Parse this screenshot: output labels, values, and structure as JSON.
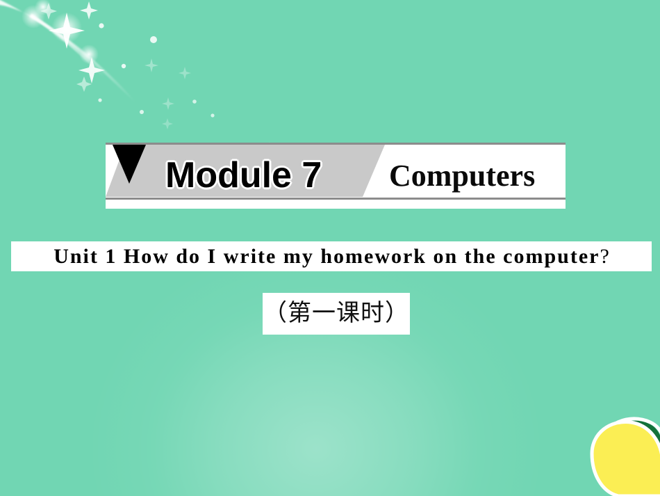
{
  "slide": {
    "background_color": "#71d6b3",
    "panel_color": "#ffffff"
  },
  "banner": {
    "module_label": "Module 7",
    "topic_label": "Computers",
    "slab_color": "#c9c9c9",
    "rule_color": "#8c8c8c",
    "triangle_color": "#000000",
    "triangle_icon_name": "down-triangle-marker"
  },
  "unit": {
    "title_main": "Unit 1    How do I write my homework on the computer",
    "title_question_mark": "?"
  },
  "period": {
    "caption": "（第一课时）"
  },
  "decorations": {
    "sparkle_name": "sparkle-comet-decoration",
    "lemon_name": "lemon-fruit-decoration",
    "lemon_body_color": "#fbee54",
    "lemon_leaf_color": "#13713a",
    "lemon_outline_color": "#ffffff"
  }
}
